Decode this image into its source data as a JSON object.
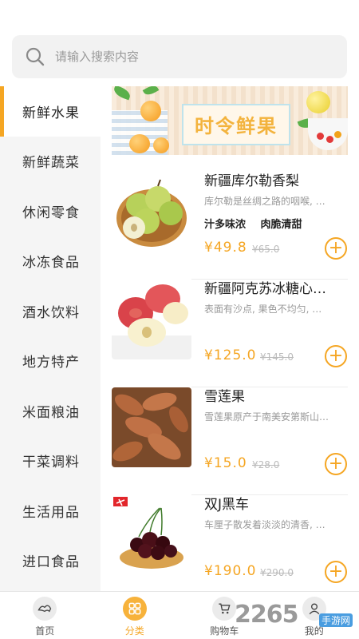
{
  "search": {
    "placeholder": "请输入搜索内容",
    "value": ""
  },
  "sidebar": {
    "items": [
      {
        "label": "新鲜水果",
        "active": true
      },
      {
        "label": "新鲜蔬菜"
      },
      {
        "label": "休闲零食"
      },
      {
        "label": "冰冻食品"
      },
      {
        "label": "酒水饮料"
      },
      {
        "label": "地方特产"
      },
      {
        "label": "米面粮油"
      },
      {
        "label": "干菜调料"
      },
      {
        "label": "生活用品"
      },
      {
        "label": "进口食品"
      }
    ]
  },
  "banner": {
    "title": "时令鲜果"
  },
  "products": [
    {
      "name": "新疆库尔勒香梨",
      "desc": "库尔勒是丝绸之路的咽喉, …",
      "tags": [
        "汁多味浓",
        "肉脆清甜"
      ],
      "price": "¥49.8",
      "old_price": "¥65.0"
    },
    {
      "name": "新疆阿克苏冰糖心…",
      "desc": "表面有沙点, 果色不均匀, …",
      "tags": [],
      "price": "¥125.0",
      "old_price": "¥145.0"
    },
    {
      "name": "雪莲果",
      "desc": "雪莲果原产于南美安第斯山…",
      "tags": [],
      "price": "¥15.0",
      "old_price": "¥28.0"
    },
    {
      "name": "双J黑车",
      "desc": "车厘子散发着淡淡的清香, …",
      "tags": [],
      "price": "¥190.0",
      "old_price": "¥290.0"
    }
  ],
  "tabbar": {
    "items": [
      {
        "label": "首页",
        "icon": "home-icon"
      },
      {
        "label": "分类",
        "icon": "category-icon",
        "active": true
      },
      {
        "label": "购物车",
        "icon": "cart-icon"
      },
      {
        "label": "我的",
        "icon": "profile-icon"
      }
    ]
  },
  "watermark": {
    "brand": "2265",
    "sub": "手游网"
  },
  "colors": {
    "accent": "#f5a623",
    "sidebar_bg": "#f5f5f5",
    "search_bg": "#f2f2f2"
  }
}
